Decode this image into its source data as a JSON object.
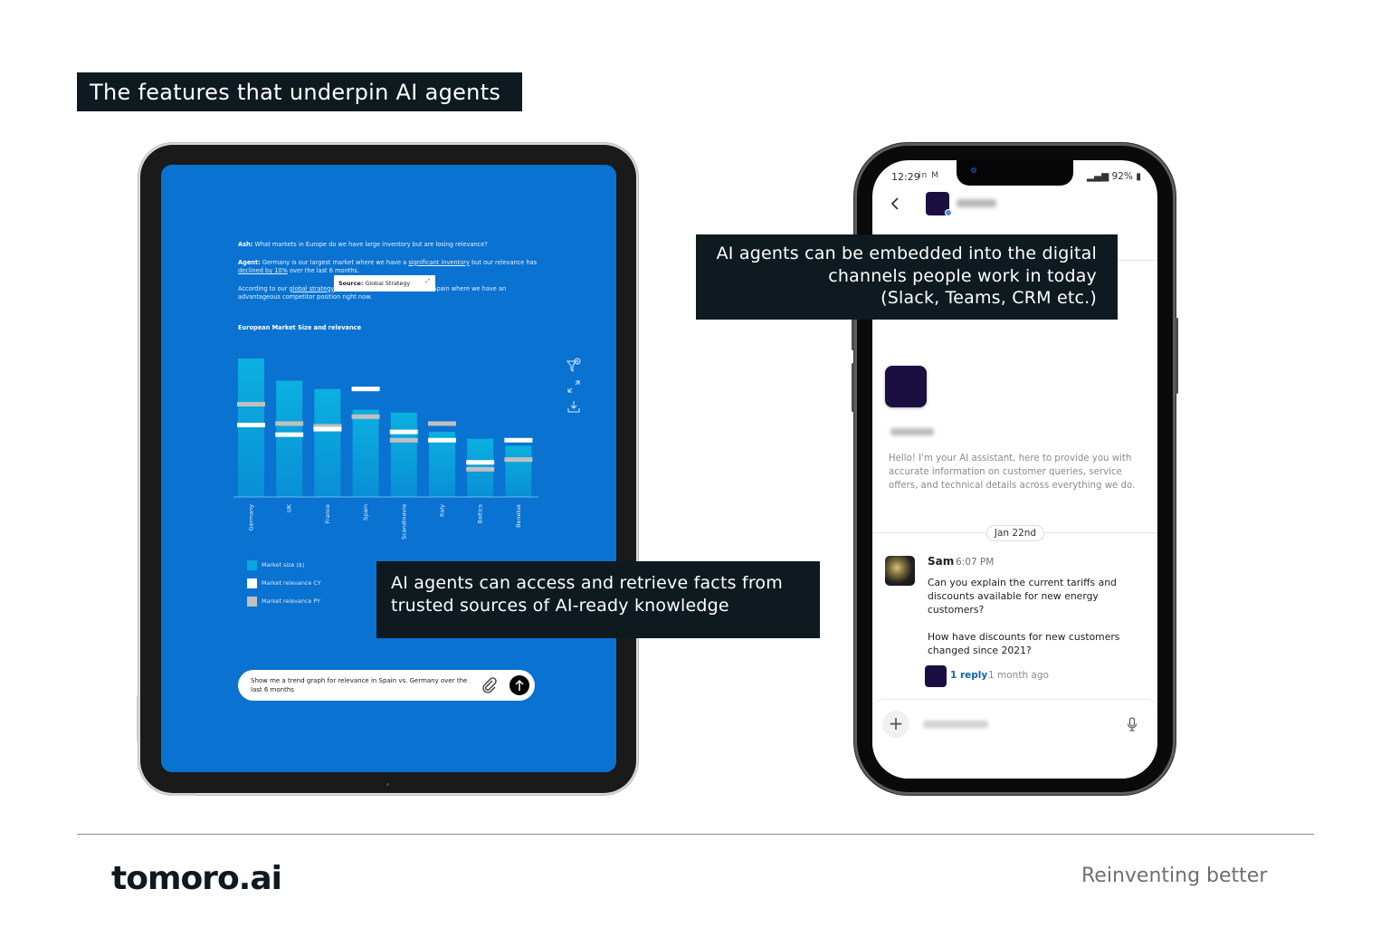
{
  "slide": {
    "title": "The features that underpin AI agents",
    "brand": "tomoro.ai",
    "tagline": "Reinventing better"
  },
  "callouts": {
    "retrieve": "AI agents can access and retrieve facts from trusted sources of AI-ready knowledge",
    "embed_lines": [
      "AI agents can be embedded into the digital",
      "channels people work in today",
      "(Slack, Teams, CRM etc.)"
    ]
  },
  "tablet": {
    "question_label": "Ash:",
    "question": "What markets in Europe do we have large inventory but are losing relevance?",
    "answer_label": "Agent:",
    "answer_part1": "Germany is our largest market where we have a",
    "answer_link1": "significant inventory",
    "answer_part2": "but our relevance has",
    "answer_link2": "declined by 10%",
    "answer_part3": "over the last 6 months.",
    "followup_part1": "According to our",
    "followup_link": "global strategy",
    "followup_part2": ", we could look to move stock to Spain where we  have an advantageous competitor position right now.",
    "source_label": "Source:",
    "source_value": "Global Strategy",
    "prompt": "Show me a trend graph for relevance in Spain vs. Germany over the last 6 months",
    "icons": {
      "filter": "filter-icon",
      "expand": "expand-icon",
      "download": "download-icon",
      "attach": "paperclip-icon",
      "send": "send-arrow-icon"
    }
  },
  "chart_data": {
    "type": "bar",
    "title": "European Market Size and relevance",
    "categories": [
      "Germany",
      "UK",
      "France",
      "Spain",
      "Scandinavia",
      "Italy",
      "Baltics",
      "Benelux"
    ],
    "series": [
      {
        "name": "Market size ($)",
        "kind": "bar",
        "color": "#0aa6dc",
        "values": [
          100,
          84,
          78,
          63,
          61,
          47,
          42,
          37
        ]
      },
      {
        "name": "Market relevance CY",
        "kind": "marker",
        "color": "#ffffff",
        "values": [
          52,
          45,
          49,
          78,
          47,
          41,
          25,
          41
        ]
      },
      {
        "name": "Market relevance PY",
        "kind": "marker",
        "color": "#c0c0c0",
        "values": [
          67,
          53,
          51,
          58,
          41,
          53,
          20,
          27
        ]
      }
    ],
    "xlabel": "",
    "ylabel": "",
    "ylim": [
      0,
      100
    ],
    "grid": false,
    "legend": "bottom-left",
    "note": "Values relative (Germany market size = 100); chart has no printed axis values"
  },
  "phone": {
    "status": {
      "time": "12:29",
      "left_icons": "in M",
      "battery": "92%"
    },
    "bot_intro": "Hello! I'm your AI assistant, here to provide you with accurate information on customer queries, service offers, and technical details across everything we do.",
    "date_divider": "Jan 22nd",
    "message": {
      "author": "Sam",
      "time": "6:07 PM",
      "lines": [
        "Can you explain the current tariffs and discounts available for new energy customers?",
        "How have discounts for new customers changed since 2021?"
      ],
      "reply_count": "1 reply",
      "reply_time": "1 month ago"
    },
    "composer": {
      "add_icon": "+"
    }
  }
}
